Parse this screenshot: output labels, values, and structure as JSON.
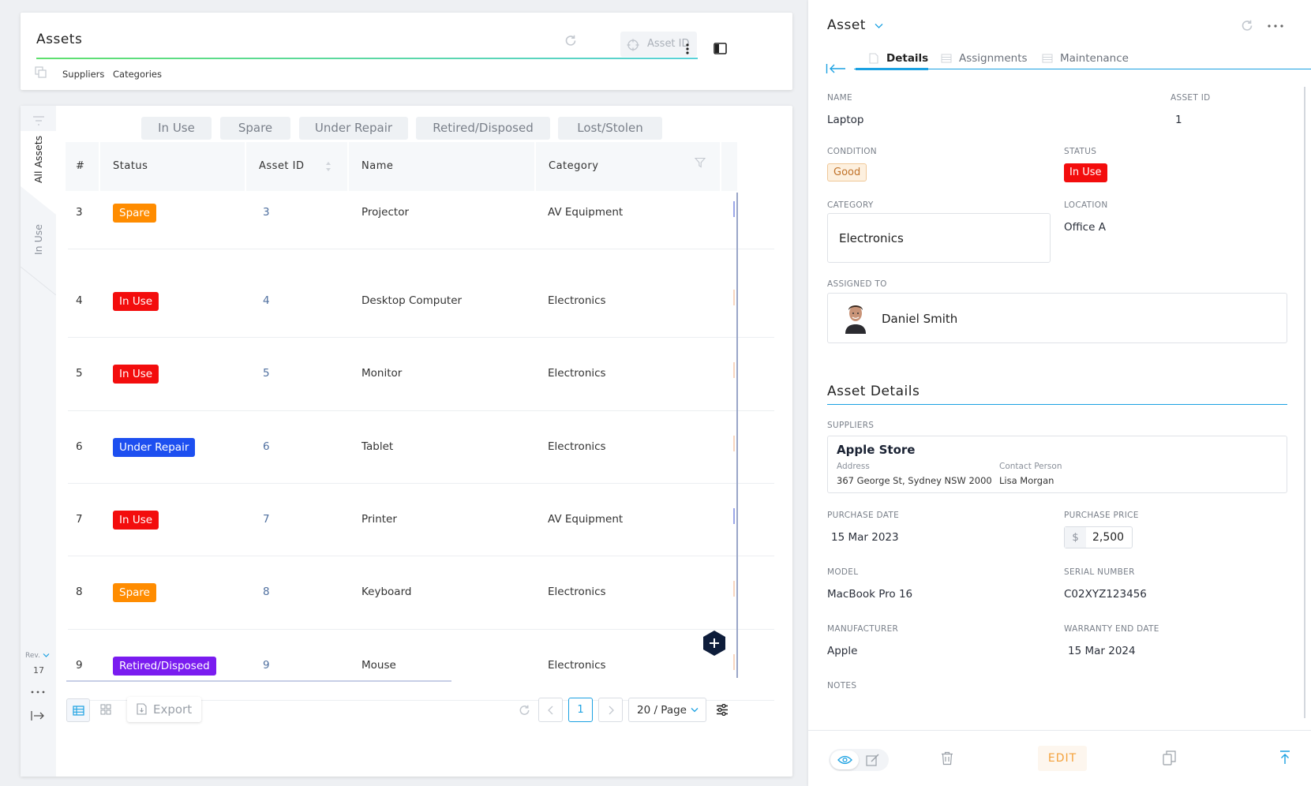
{
  "header": {
    "title": "Assets",
    "asset_id_placeholder": "Asset ID",
    "links": [
      "Suppliers",
      "Categories"
    ]
  },
  "sidebar": {
    "tabs": [
      "All Assets",
      "In Use"
    ],
    "rev_label": "Rev.",
    "rev_value": "17"
  },
  "filters": [
    "In Use",
    "Spare",
    "Under Repair",
    "Retired/Disposed",
    "Lost/Stolen"
  ],
  "table": {
    "columns": [
      "#",
      "Status",
      "Asset ID",
      "Name",
      "Category"
    ],
    "rows": [
      {
        "num": "3",
        "status": "Spare",
        "status_color": "#ff8c00",
        "asset_id": "3",
        "name": "Projector",
        "category": "AV Equipment"
      },
      {
        "num": "4",
        "status": "In Use",
        "status_color": "#f30d0d",
        "asset_id": "4",
        "name": "Desktop Computer",
        "category": "Electronics"
      },
      {
        "num": "5",
        "status": "In Use",
        "status_color": "#f30d0d",
        "asset_id": "5",
        "name": "Monitor",
        "category": "Electronics"
      },
      {
        "num": "6",
        "status": "Under Repair",
        "status_color": "#1d4ff0",
        "asset_id": "6",
        "name": "Tablet",
        "category": "Electronics"
      },
      {
        "num": "7",
        "status": "In Use",
        "status_color": "#f30d0d",
        "asset_id": "7",
        "name": "Printer",
        "category": "AV Equipment"
      },
      {
        "num": "8",
        "status": "Spare",
        "status_color": "#ff8c00",
        "asset_id": "8",
        "name": "Keyboard",
        "category": "Electronics"
      },
      {
        "num": "9",
        "status": "Retired/Disposed",
        "status_color": "#7a1cf0",
        "asset_id": "9",
        "name": "Mouse",
        "category": "Electronics"
      }
    ]
  },
  "footer": {
    "export_label": "Export",
    "page": "1",
    "page_size": "20 / Page"
  },
  "panel": {
    "title": "Asset",
    "tabs": [
      "Details",
      "Assignments",
      "Maintenance"
    ],
    "name_label": "NAME",
    "name": "Laptop",
    "asset_id_label": "ASSET ID",
    "asset_id": "1",
    "condition_label": "CONDITION",
    "condition": "Good",
    "status_label": "STATUS",
    "status": "In Use",
    "category_label": "CATEGORY",
    "category": "Electronics",
    "location_label": "LOCATION",
    "location": "Office A",
    "assigned_label": "ASSIGNED TO",
    "assigned": "Daniel Smith",
    "section_title": "Asset Details",
    "suppliers_label": "SUPPLIERS",
    "supplier_name": "Apple Store",
    "address_label": "Address",
    "address": "367 George St, Sydney NSW 2000",
    "contact_label": "Contact Person",
    "contact": "Lisa Morgan",
    "purchase_date_label": "PURCHASE DATE",
    "purchase_date": "15 Mar 2023",
    "purchase_price_label": "PURCHASE PRICE",
    "currency": "$",
    "purchase_price": "2,500",
    "model_label": "MODEL",
    "model": "MacBook Pro 16",
    "serial_label": "SERIAL NUMBER",
    "serial": "C02XYZ123456",
    "manufacturer_label": "MANUFACTURER",
    "manufacturer": "Apple",
    "warranty_label": "WARRANTY END DATE",
    "warranty": "15 Mar 2024",
    "notes_label": "NOTES",
    "edit_label": "EDIT"
  },
  "colors": {
    "accent": "#1ba1e2",
    "in_use": "#f30d0d",
    "spare": "#ff8c00",
    "under_repair": "#1d4ff0",
    "retired": "#7a1cf0",
    "good_bg": "#fdf0df",
    "good_text": "#c0722a"
  }
}
